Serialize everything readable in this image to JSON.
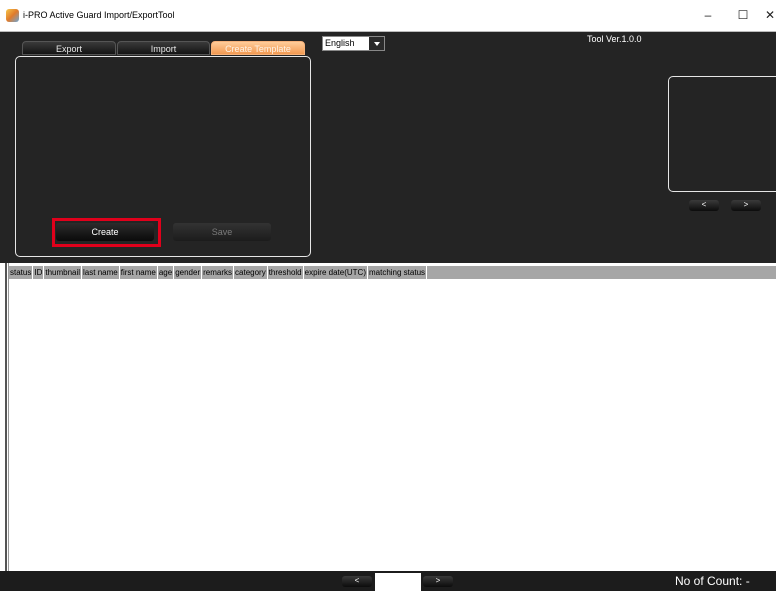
{
  "window": {
    "title": "i-PRO Active Guard Import/ExportTool",
    "minimize": "–",
    "maximize": "☐",
    "close": "✕"
  },
  "tabs": [
    "Export",
    "Import",
    "Create Template"
  ],
  "language": {
    "selected": "English"
  },
  "version": "Tool Ver.1.0.0",
  "buttons": {
    "create": "Create",
    "save": "Save"
  },
  "preview_nav": {
    "prev": "<",
    "next": ">"
  },
  "table": {
    "columns": [
      "status",
      "ID",
      "thumbnail",
      "last name",
      "first name",
      "age",
      "gender",
      "remarks",
      "category",
      "threshold",
      "expire date(UTC)",
      "matching status"
    ]
  },
  "footer": {
    "prev": "<",
    "next": ">",
    "page": "",
    "count": "No of Count: -"
  },
  "colors": {
    "background": "#242424",
    "active_tab": "#f29a52",
    "highlight": "#e0001b",
    "header": "#a6a6a6"
  }
}
